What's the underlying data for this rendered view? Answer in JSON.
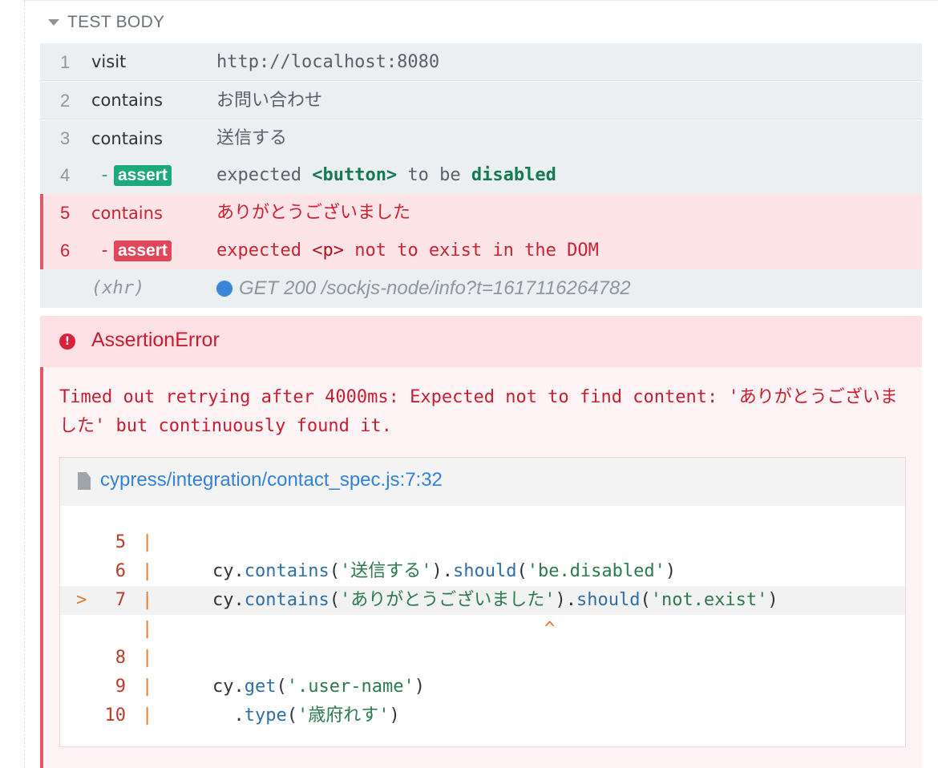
{
  "section": {
    "title": "TEST BODY"
  },
  "commands": [
    {
      "num": "1",
      "name": "visit",
      "message": "http://localhost:8080"
    },
    {
      "num": "2",
      "name": "contains",
      "message": "お問い合わせ"
    },
    {
      "num": "3",
      "name": "contains",
      "message": "送信する"
    },
    {
      "num": "4",
      "name": "assert",
      "message_parts": [
        "expected",
        "<button>",
        "to be",
        "disabled"
      ]
    },
    {
      "num": "5",
      "name": "contains",
      "message": "ありがとうございました"
    },
    {
      "num": "6",
      "name": "assert",
      "message_parts": [
        "expected",
        "<p>",
        "not to exist in the DOM"
      ]
    },
    {
      "num": "",
      "name": "(xhr)",
      "message": "GET 200 /sockjs-node/info?t=1617116264782"
    }
  ],
  "assert_dash": "-",
  "error": {
    "type": "AssertionError",
    "message": "Timed out retrying after 4000ms: Expected not to find content: 'ありがとうございました' but continuously found it.",
    "file_link": "cypress/integration/contact_spec.js:7:32",
    "code_lines": [
      {
        "arrow": "",
        "num": "5",
        "pipe": "|",
        "code": ""
      },
      {
        "arrow": "",
        "num": "6",
        "pipe": "|",
        "code": "cy.contains('送信する').should('be.disabled')"
      },
      {
        "arrow": ">",
        "num": "7",
        "pipe": "|",
        "code": "cy.contains('ありがとうございました').should('not.exist')"
      },
      {
        "arrow": "",
        "num": "",
        "pipe": "|",
        "code": "^"
      },
      {
        "arrow": "",
        "num": "8",
        "pipe": "|",
        "code": ""
      },
      {
        "arrow": "",
        "num": "9",
        "pipe": "|",
        "code": "cy.get('.user-name')"
      },
      {
        "arrow": "",
        "num": "10",
        "pipe": "|",
        "code": "  .type('歳府れす')"
      }
    ]
  },
  "colors": {
    "pass": "#1fa97a",
    "fail": "#e0475a",
    "xhr_dot": "#3b86d8",
    "link": "#3382d8"
  },
  "icons": {
    "caret": "caret-down-icon",
    "error": "exclamation-circle-icon",
    "file": "file-icon"
  }
}
